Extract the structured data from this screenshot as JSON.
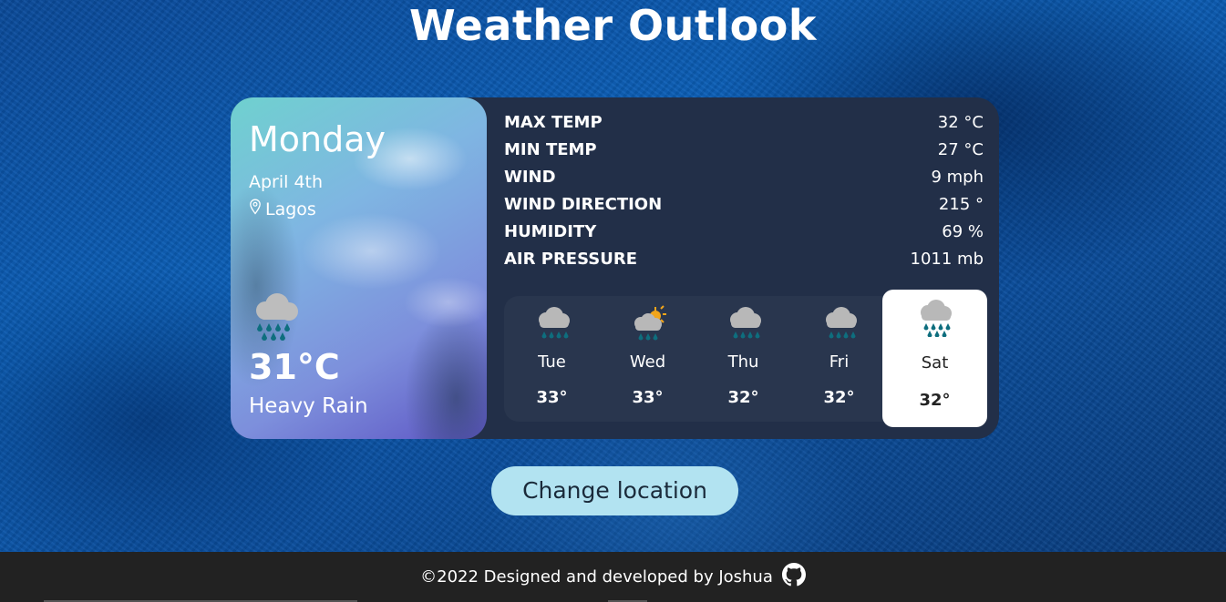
{
  "page": {
    "title": "Weather Outlook"
  },
  "today": {
    "day": "Monday",
    "date": "April 4th",
    "location": "Lagos",
    "temperature": "31°C",
    "condition": "Heavy Rain",
    "icon": "heavy-rain-icon"
  },
  "details": [
    {
      "label": "MAX TEMP",
      "value": "32 °C"
    },
    {
      "label": "MIN TEMP",
      "value": "27 °C"
    },
    {
      "label": "WIND",
      "value": "9 mph"
    },
    {
      "label": "WIND DIRECTION",
      "value": "215 °"
    },
    {
      "label": "HUMIDITY",
      "value": "69 %"
    },
    {
      "label": "AIR PRESSURE",
      "value": "1011 mb"
    }
  ],
  "forecast": [
    {
      "day": "Tue",
      "temp": "33°",
      "icon": "light-rain-icon"
    },
    {
      "day": "Wed",
      "temp": "33°",
      "icon": "sun-cloud-rain-icon"
    },
    {
      "day": "Thu",
      "temp": "32°",
      "icon": "light-rain-icon"
    },
    {
      "day": "Fri",
      "temp": "32°",
      "icon": "light-rain-icon"
    },
    {
      "day": "Sat",
      "temp": "32°",
      "icon": "heavy-rain-icon",
      "active": true
    }
  ],
  "actions": {
    "change_location": "Change location"
  },
  "footer": {
    "text": "©2022 Designed and developed by Joshua",
    "icon": "github-icon"
  },
  "colors": {
    "card": "#222f48",
    "forecast_panel": "#29364e",
    "button": "#b2e3f1",
    "footer": "#222222",
    "rain_drop": "#0e6e7e",
    "cloud": "#b8b8b8",
    "sun": "#f2a51a"
  }
}
